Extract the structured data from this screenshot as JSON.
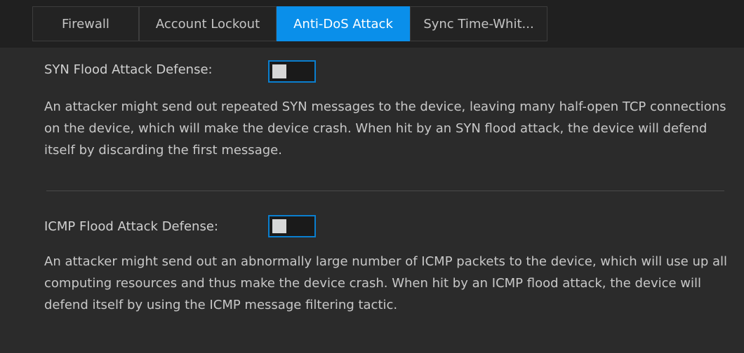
{
  "tabs": [
    {
      "label": "Firewall",
      "active": false
    },
    {
      "label": "Account Lockout",
      "active": false
    },
    {
      "label": "Anti-DoS Attack",
      "active": true
    },
    {
      "label": "Sync Time-Whit...",
      "active": false
    }
  ],
  "syn": {
    "label": "SYN Flood Attack Defense:",
    "enabled": false,
    "description": "An attacker might send out repeated SYN messages to the device, leaving many half-open TCP connections on the device, which will make the device crash. When hit by an SYN flood attack, the device will defend itself by discarding the first message."
  },
  "icmp": {
    "label": "ICMP Flood Attack Defense:",
    "enabled": false,
    "description": "An attacker might send out an abnormally large number of ICMP packets to the device, which will use up all computing resources and thus make the device crash. When hit by an ICMP flood attack, the device will defend itself by using the ICMP message filtering tactic."
  },
  "colors": {
    "background": "#2b2b2b",
    "tabbar": "#202020",
    "accent": "#0a8fea",
    "text": "#c8c8c8"
  }
}
